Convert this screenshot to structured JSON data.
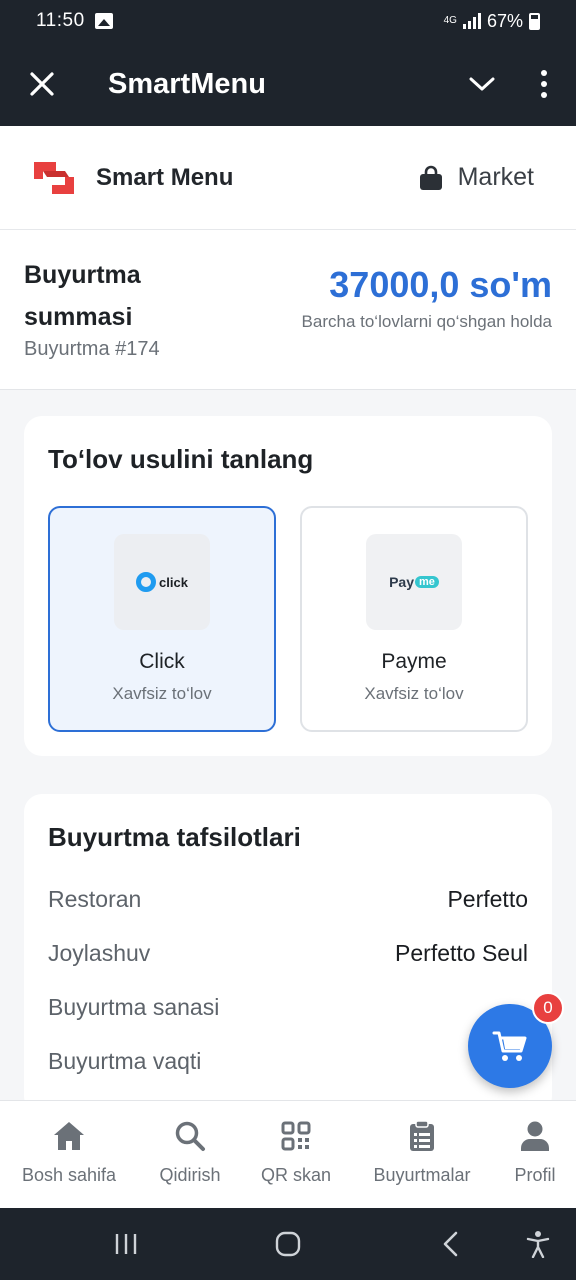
{
  "status_bar": {
    "time": "11:50",
    "network": "4G",
    "battery": "67%"
  },
  "app_bar": {
    "title": "SmartMenu"
  },
  "brand_bar": {
    "name": "Smart Menu",
    "market_label": "Market"
  },
  "summary": {
    "label": "Buyurtma summasi",
    "order_number": "Buyurtma #174",
    "amount": "37000,0 so'm",
    "note": "Barcha to‘lovlarni qo‘shgan holda"
  },
  "payment": {
    "title": "To‘lov usulini tanlang",
    "options": [
      {
        "name": "Click",
        "desc": "Xavfsiz to‘lov",
        "logo_text": "click",
        "selected": true
      },
      {
        "name": "Payme",
        "desc": "Xavfsiz to‘lov",
        "logo_text": "Pay",
        "logo_badge": "me",
        "selected": false
      }
    ]
  },
  "details": {
    "title": "Buyurtma tafsilotlari",
    "rows": [
      {
        "key": "Restoran",
        "value": "Perfetto"
      },
      {
        "key": "Joylashuv",
        "value": "Perfetto Seul"
      },
      {
        "key": "Buyurtma sanasi",
        "value": ""
      },
      {
        "key": "Buyurtma vaqti",
        "value": ""
      }
    ]
  },
  "cart": {
    "count": "0"
  },
  "bottom_nav": {
    "items": [
      {
        "label": "Bosh sahifa",
        "icon": "home-icon"
      },
      {
        "label": "Qidirish",
        "icon": "search-icon"
      },
      {
        "label": "QR skan",
        "icon": "qr-icon"
      },
      {
        "label": "Buyurtmalar",
        "icon": "clipboard-icon"
      },
      {
        "label": "Profil",
        "icon": "person-icon"
      }
    ]
  },
  "colors": {
    "accent": "#2d6fd6",
    "dark_bar": "#1e242c",
    "badge": "#e8403f"
  }
}
